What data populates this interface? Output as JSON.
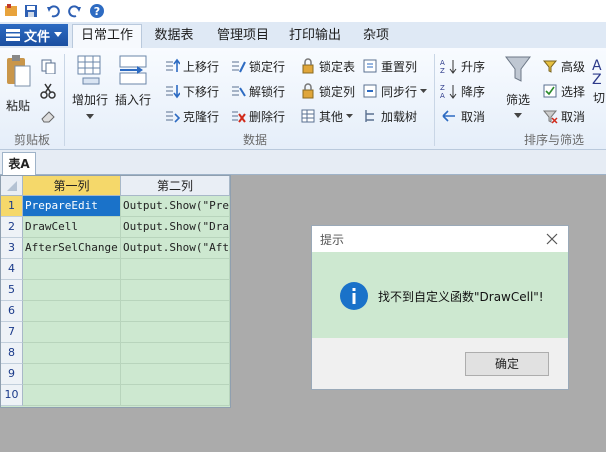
{
  "ribbon_tabs": {
    "file": "文件",
    "home": "日常工作",
    "data_table": "数据表",
    "manage": "管理项目",
    "print": "打印输出",
    "misc": "杂项"
  },
  "clipboard": {
    "paste": "粘贴",
    "group": "剪贴板"
  },
  "data_group": {
    "add_row": "增加行",
    "insert_row": "插入行",
    "move_up": "上移行",
    "move_down": "下移行",
    "clone_row": "克隆行",
    "lock_row": "锁定行",
    "unlock_row": "解锁行",
    "delete_row": "删除行",
    "lock_table": "锁定表",
    "lock_column": "锁定列",
    "other": "其他",
    "reset_column": "重置列",
    "sync_row": "同步行",
    "load_tree": "加载树",
    "group": "数据"
  },
  "sort_group": {
    "ascending": "升序",
    "descending": "降序",
    "cancel_sort": "取消",
    "filter": "筛选",
    "advanced": "高级",
    "select": "选择",
    "cancel_filter": "取消",
    "cut_partial": "切",
    "group": "排序与筛选"
  },
  "sheet": {
    "tab": "表A"
  },
  "grid": {
    "columns": [
      "第一列",
      "第二列"
    ],
    "row_numbers": [
      "1",
      "2",
      "3",
      "4",
      "5",
      "6",
      "7",
      "8",
      "9",
      "10"
    ],
    "rows": [
      [
        "PrepareEdit",
        "Output.Show(\"Pre"
      ],
      [
        "DrawCell",
        "Output.Show(\"Dra"
      ],
      [
        "AfterSelChange",
        "Output.Show(\"Aft"
      ]
    ]
  },
  "dialog": {
    "title": "提示",
    "message": "找不到自定义函数\"DrawCell\"!",
    "ok": "确定"
  },
  "colors": {
    "accent": "#1a72c9",
    "grid_bg": "#cde8d0",
    "selected_header": "#f5d86a"
  }
}
